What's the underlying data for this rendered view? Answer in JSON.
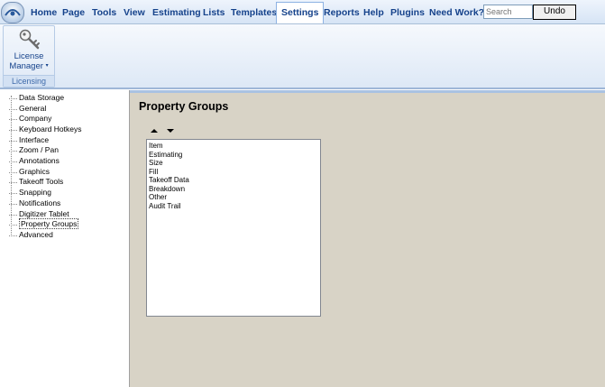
{
  "menubar": {
    "items": [
      {
        "label": "Home"
      },
      {
        "label": "Page"
      },
      {
        "label": "Tools"
      },
      {
        "label": "View"
      },
      {
        "label": "Estimating"
      },
      {
        "label": "Lists"
      },
      {
        "label": "Templates"
      },
      {
        "label": "Settings",
        "active": true
      },
      {
        "label": "Reports"
      },
      {
        "label": "Help"
      },
      {
        "label": "Plugins"
      },
      {
        "label": "Need Work?"
      }
    ],
    "search_placeholder": "Search",
    "undo_label": "Undo"
  },
  "ribbon": {
    "button_label_line1": "License",
    "button_label_line2": "Manager",
    "group_caption": "Licensing"
  },
  "tree": {
    "items": [
      {
        "label": "Data Storage"
      },
      {
        "label": "General"
      },
      {
        "label": "Company"
      },
      {
        "label": "Keyboard Hotkeys"
      },
      {
        "label": "Interface"
      },
      {
        "label": "Zoom / Pan"
      },
      {
        "label": "Annotations"
      },
      {
        "label": "Graphics"
      },
      {
        "label": "Takeoff Tools"
      },
      {
        "label": "Snapping"
      },
      {
        "label": "Notifications"
      },
      {
        "label": "Digitizer Tablet"
      },
      {
        "label": "Property Groups",
        "selected": true
      },
      {
        "label": "Advanced"
      }
    ]
  },
  "main": {
    "title": "Property Groups",
    "list_items": [
      "Item",
      "Estimating",
      "Size",
      "Fill",
      "Takeoff Data",
      "Breakdown",
      "Other",
      "Audit Trail"
    ]
  },
  "colors": {
    "menu_text": "#15428b",
    "content_bg": "#d8d3c6",
    "ribbon_border": "#9fb7d7"
  }
}
